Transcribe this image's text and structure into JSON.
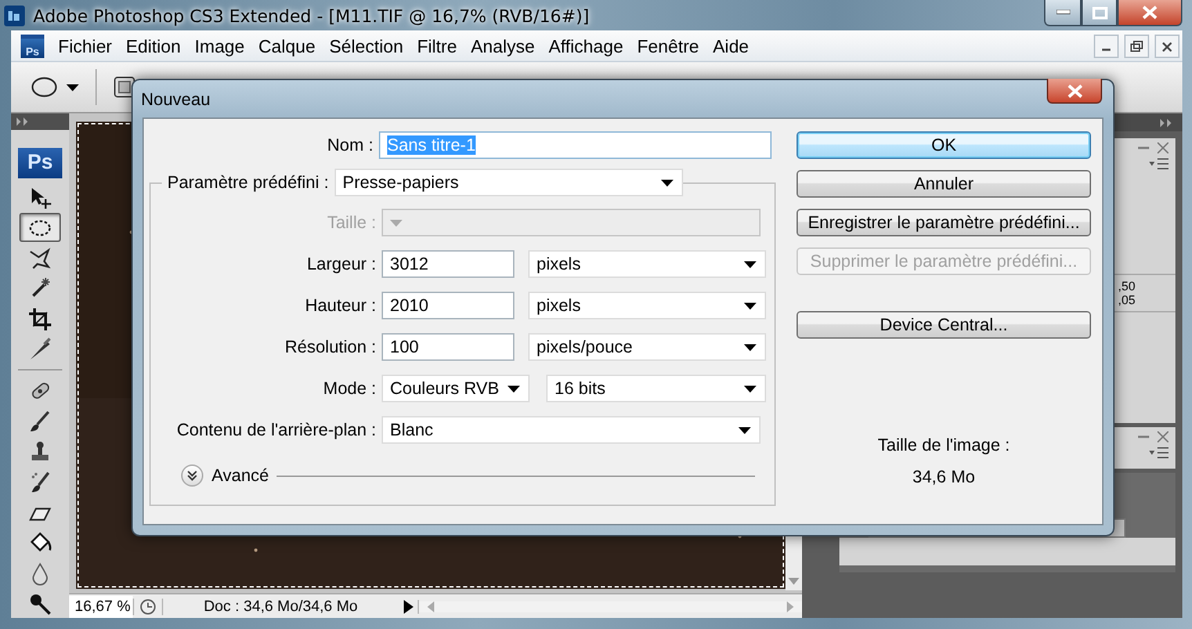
{
  "app_window": {
    "title": "Adobe Photoshop CS3 Extended - [M11.TIF @ 16,7% (RVB/16#)]"
  },
  "menu_bar": {
    "logo": "Ps",
    "items": [
      "Fichier",
      "Edition",
      "Image",
      "Calque",
      "Sélection",
      "Filtre",
      "Analyse",
      "Affichage",
      "Fenêtre",
      "Aide"
    ]
  },
  "toolbox": {
    "logo": "Ps",
    "tools": [
      {
        "kind": "move",
        "selected": false
      },
      {
        "kind": "ellipse",
        "selected": true
      },
      {
        "kind": "lasso",
        "selected": false
      },
      {
        "kind": "wand",
        "selected": false
      },
      {
        "kind": "crop",
        "selected": false
      },
      {
        "kind": "slice",
        "selected": false
      },
      {
        "kind": "heal",
        "selected": false
      },
      {
        "kind": "brush",
        "selected": false
      },
      {
        "kind": "stamp",
        "selected": false
      },
      {
        "kind": "history",
        "selected": false
      },
      {
        "kind": "eraser",
        "selected": false
      },
      {
        "kind": "bucket",
        "selected": false
      },
      {
        "kind": "blur",
        "selected": false
      },
      {
        "kind": "dodge",
        "selected": false
      }
    ]
  },
  "status_bar": {
    "zoom": "16,67 %",
    "doc_info": "Doc : 34,6 Mo/34,6 Mo"
  },
  "side_panel": {
    "values": [
      ",50",
      ",05"
    ]
  },
  "dialog": {
    "title": "Nouveau",
    "name_field": {
      "label": "Nom :",
      "value": "Sans titre-1",
      "text_selected": true
    },
    "preset": {
      "label": "Paramètre prédéfini :",
      "value": "Presse-papiers"
    },
    "rows": [
      {
        "kind": "select",
        "label": "Taille :",
        "disabled": true
      },
      {
        "kind": "number_unit",
        "label": "Largeur :",
        "value": "3012",
        "unit": "pixels",
        "disabled": false
      },
      {
        "kind": "number_unit",
        "label": "Hauteur :",
        "value": "2010",
        "unit": "pixels",
        "disabled": false
      },
      {
        "kind": "number_unit",
        "label": "Résolution :",
        "value": "100",
        "unit": "pixels/pouce",
        "disabled": false
      },
      {
        "kind": "two_select",
        "label": "Mode :",
        "value": "Couleurs RVB",
        "unit": "16 bits",
        "disabled": false
      },
      {
        "kind": "select",
        "label": "Contenu de l'arrière-plan :",
        "value": "Blanc",
        "disabled": false
      }
    ],
    "advanced": {
      "label": "Avancé",
      "expanded": false
    },
    "buttons": [
      {
        "label": "OK",
        "default": true,
        "disabled": false
      },
      {
        "label": "Annuler",
        "default": false,
        "disabled": false
      },
      {
        "label": "Enregistrer le paramètre prédéfini...",
        "default": false,
        "disabled": false
      },
      {
        "label": "Supprimer le paramètre prédéfini...",
        "default": false,
        "disabled": true
      }
    ],
    "device_button": {
      "label": "Device Central..."
    },
    "image_size": {
      "label": "Taille de l'image :",
      "value": "34,6 Mo"
    }
  }
}
